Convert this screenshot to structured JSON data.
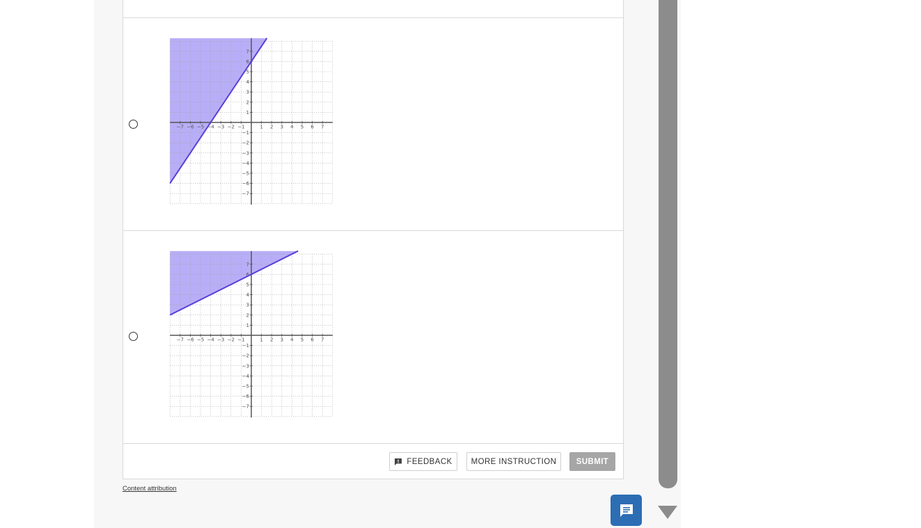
{
  "options": [
    {
      "id": "option-1",
      "graph": {
        "x_range": [
          -8,
          8
        ],
        "y_range": [
          -8,
          8
        ],
        "x_ticks": [
          "−7",
          "−6",
          "−5",
          "−4",
          "−3",
          "−2",
          "−1",
          "1",
          "2",
          "3",
          "4",
          "5",
          "6",
          "7"
        ],
        "y_ticks": [
          "7",
          "6",
          "5",
          "4",
          "3",
          "2",
          "1",
          "−1",
          "−2",
          "−3",
          "−4",
          "−5",
          "−6",
          "−7"
        ],
        "line": {
          "slope": 1.5,
          "intercept": 6
        },
        "shading": "above",
        "line_color": "#5a3fd8",
        "fill_color": "#b8aef7"
      }
    },
    {
      "id": "option-2",
      "graph": {
        "x_range": [
          -8,
          8
        ],
        "y_range": [
          -8,
          8
        ],
        "x_ticks": [
          "−7",
          "−6",
          "−5",
          "−4",
          "−3",
          "−2",
          "−1",
          "1",
          "2",
          "3",
          "4",
          "5",
          "6",
          "7"
        ],
        "y_ticks": [
          "7",
          "6",
          "5",
          "4",
          "3",
          "2",
          "1",
          "−1",
          "−2",
          "−3",
          "−4",
          "−5",
          "−6",
          "−7"
        ],
        "line": {
          "slope": 0.5,
          "intercept": 6
        },
        "shading": "above",
        "line_color": "#5a3fd8",
        "fill_color": "#b8aef7"
      }
    }
  ],
  "buttons": {
    "feedback": "FEEDBACK",
    "more_instruction": "MORE INSTRUCTION",
    "submit": "SUBMIT"
  },
  "attribution": "Content attribution",
  "icons": {
    "feedback": "feedback-icon",
    "chat": "chat-icon",
    "scroll_down": "scroll-down-icon"
  },
  "colors": {
    "chat_button": "#2c6db4",
    "submit_disabled": "#a6a6a6",
    "scrollbar": "#8c8c8c"
  }
}
